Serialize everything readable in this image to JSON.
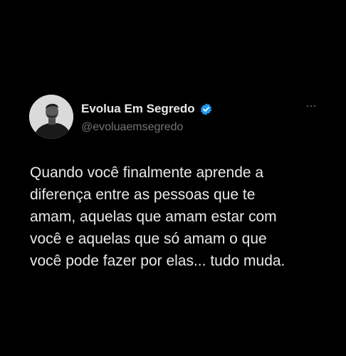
{
  "colors": {
    "background": "#000000",
    "text_primary": "#e7e9ea",
    "text_secondary": "#71767b",
    "verified_badge": "#1d9bf0"
  },
  "author": {
    "name": "Evolua Em Segredo",
    "handle": "@evoluaemsegredo",
    "verified": true,
    "avatar_icon": "profile-photo"
  },
  "more_menu": {
    "icon": "ellipsis-icon"
  },
  "tweet": {
    "lines": [
      "Quando você finalmente aprende a",
      "diferença entre as pessoas que te",
      "amam, aquelas que amam estar com",
      "você e aquelas que só amam o que",
      "você pode fazer por elas... tudo muda."
    ]
  }
}
